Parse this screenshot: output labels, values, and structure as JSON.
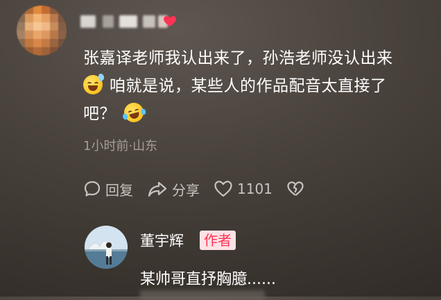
{
  "comment": {
    "author_name": "",
    "line1": "张嘉译老师我认出来了，孙浩老师没认出来",
    "line2": "咱就是说，某些人的作品配音太直接了",
    "line3": "吧？",
    "emoji_1": "sweat-smile-emoji",
    "emoji_2": "laugh-cry-emoji",
    "meta": "1小时前·山东",
    "actions": {
      "reply_label": "回复",
      "share_label": "分享",
      "like_count": "1101"
    }
  },
  "reply": {
    "author_name": "董宇辉",
    "badge": "作者",
    "text": "某帅哥直抒胸臆......"
  },
  "colors": {
    "badge_text": "#ff3355",
    "badge_bg": "#ffe2e6",
    "meta_text": "#a49d96",
    "heart_accent": "#ff3355"
  }
}
